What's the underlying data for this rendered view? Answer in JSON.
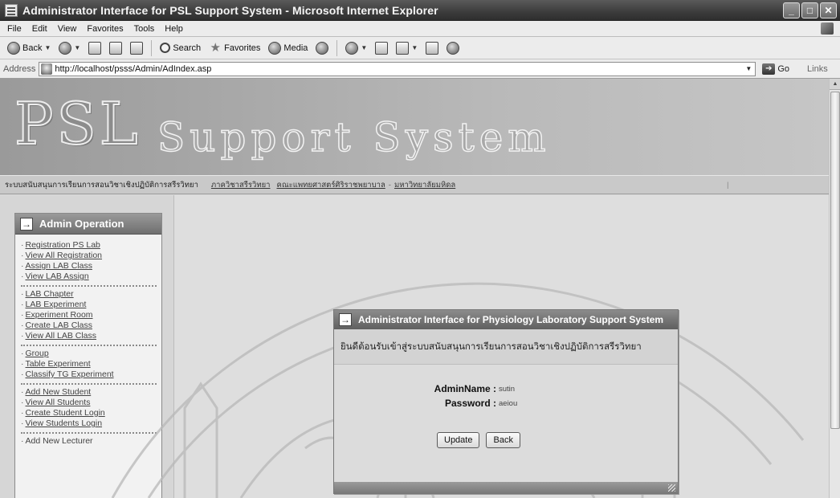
{
  "window": {
    "title": "Administrator Interface for PSL Support System - Microsoft Internet Explorer",
    "controls": [
      "_",
      "□",
      "✕"
    ]
  },
  "menu": [
    "File",
    "Edit",
    "View",
    "Favorites",
    "Tools",
    "Help"
  ],
  "toolbar": {
    "back": "Back",
    "search": "Search",
    "favorites": "Favorites",
    "media": "Media"
  },
  "address": {
    "label": "Address",
    "url": "http://localhost/psss/Admin/AdIndex.asp",
    "go": "Go",
    "links": "Links"
  },
  "banner": {
    "logo": "PSL",
    "subtitle": "Support System"
  },
  "nav": {
    "site_name": "ระบบสนับสนุนการเรียนการสอนวิชาเชิงปฏิบัติการสรีรวิทยา",
    "dept": "ภาควิชาสรีรวิทยา",
    "faculty": "คณะแพทยศาสตร์ศิริราชพยาบาล",
    "university": "มหาวิทยาลัยมหิดล",
    "sep": "-",
    "endpipe": "|"
  },
  "sidebar": {
    "title": "Admin Operation",
    "groups": [
      {
        "items": [
          "Registration PS Lab",
          "View All Registration",
          "Assign LAB Class",
          "View LAB Assign"
        ]
      },
      {
        "items": [
          "LAB Chapter",
          "LAB Experiment",
          "Experiment Room",
          "Create LAB Class",
          "View All LAB Class"
        ]
      },
      {
        "items": [
          "Group",
          "Table Experiment",
          "Classify TG Experiment"
        ]
      },
      {
        "items": [
          "Add New Student",
          "View All Students",
          "Create Student Login",
          "View Students Login"
        ]
      },
      {
        "items": [
          "Add New Lecturer"
        ]
      }
    ]
  },
  "dialog": {
    "title": "Administrator Interface for Physiology Laboratory Support System",
    "welcome": "ยินดีต้อนรับเข้าสู่ระบบสนับสนุนการเรียนการสอนวิชาเชิงปฏิบัติการสรีรวิทยา",
    "admin_label": "AdminName :",
    "admin_value": "sutin",
    "password_label": "Password :",
    "password_value": "aeiou",
    "update_button": "Update",
    "back_button": "Back"
  },
  "colors": {
    "titlebar": "#3c3c3c",
    "panel_header": "#7a7a7a",
    "page_bg": "#dedede"
  }
}
